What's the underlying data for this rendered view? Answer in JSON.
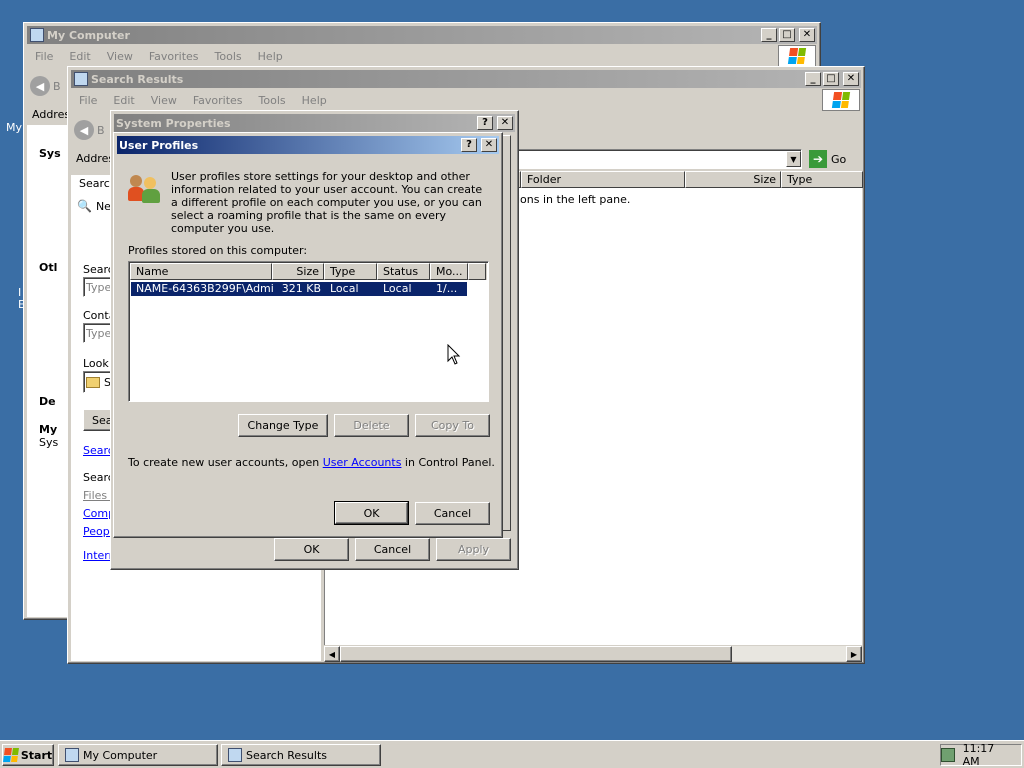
{
  "desktop": {
    "fragments": [
      "My",
      "I",
      "E"
    ]
  },
  "my_computer": {
    "title": "My Computer",
    "menu": [
      "File",
      "Edit",
      "View",
      "Favorites",
      "Tools",
      "Help"
    ],
    "back_frag": "B",
    "address_frag": "Addres",
    "sidebar": {
      "sys_frag": "Sys",
      "other_frag": "Otl",
      "details_frag": "De",
      "details_name_frag": "My",
      "details_sub_frag": "Sys"
    }
  },
  "search_results": {
    "title": "Search Results",
    "menu": [
      "File",
      "Edit",
      "View",
      "Favorites",
      "Tools",
      "Help"
    ],
    "back_frag": "B",
    "address_frag": "Addres",
    "go_label": "Go",
    "columns": [
      "Folder",
      "Size",
      "Type"
    ],
    "pane_text_frag": "ions in the left pane.",
    "side": {
      "search_frag": "Search",
      "new_frag": "Ne",
      "search_for_frag": "Searc",
      "type_frag": "Type",
      "containing_frag": "Conta",
      "type2_frag": "Type",
      "look_in_frag": "Look",
      "s_frag": "S",
      "search_btn_frag": "Sea",
      "search_link_frag": "Searc",
      "search2_frag": "Searc",
      "files_frag": "Files c",
      "comp_frag": "Comp",
      "people_frag": "Peopl",
      "internet_frag": "Intern"
    }
  },
  "system_properties": {
    "title": "System Properties",
    "ok_label": "OK",
    "cancel_label": "Cancel",
    "apply_label": "Apply"
  },
  "user_profiles": {
    "title": "User Profiles",
    "description": "User profiles store settings for your desktop and other information related to your user account. You can create a different profile on each computer you use, or you can select a roaming profile that is the same on every computer you use.",
    "list_label": "Profiles stored on this computer:",
    "columns": [
      "Name",
      "Size",
      "Type",
      "Status",
      "Mo..."
    ],
    "rows": [
      {
        "name": "NAME-64363B299F\\Admi...",
        "size": "321 KB",
        "type": "Local",
        "status": "Local",
        "modified": "1/..."
      }
    ],
    "change_type_label": "Change Type",
    "delete_label": "Delete",
    "copy_to_label": "Copy To",
    "footer_pre": "To create new user accounts, open ",
    "footer_link": "User Accounts",
    "footer_post": " in Control Panel.",
    "ok_label": "OK",
    "cancel_label": "Cancel"
  },
  "taskbar": {
    "start_label": "Start",
    "tasks": [
      "My Computer",
      "Search Results"
    ],
    "clock": "11:17 AM"
  }
}
